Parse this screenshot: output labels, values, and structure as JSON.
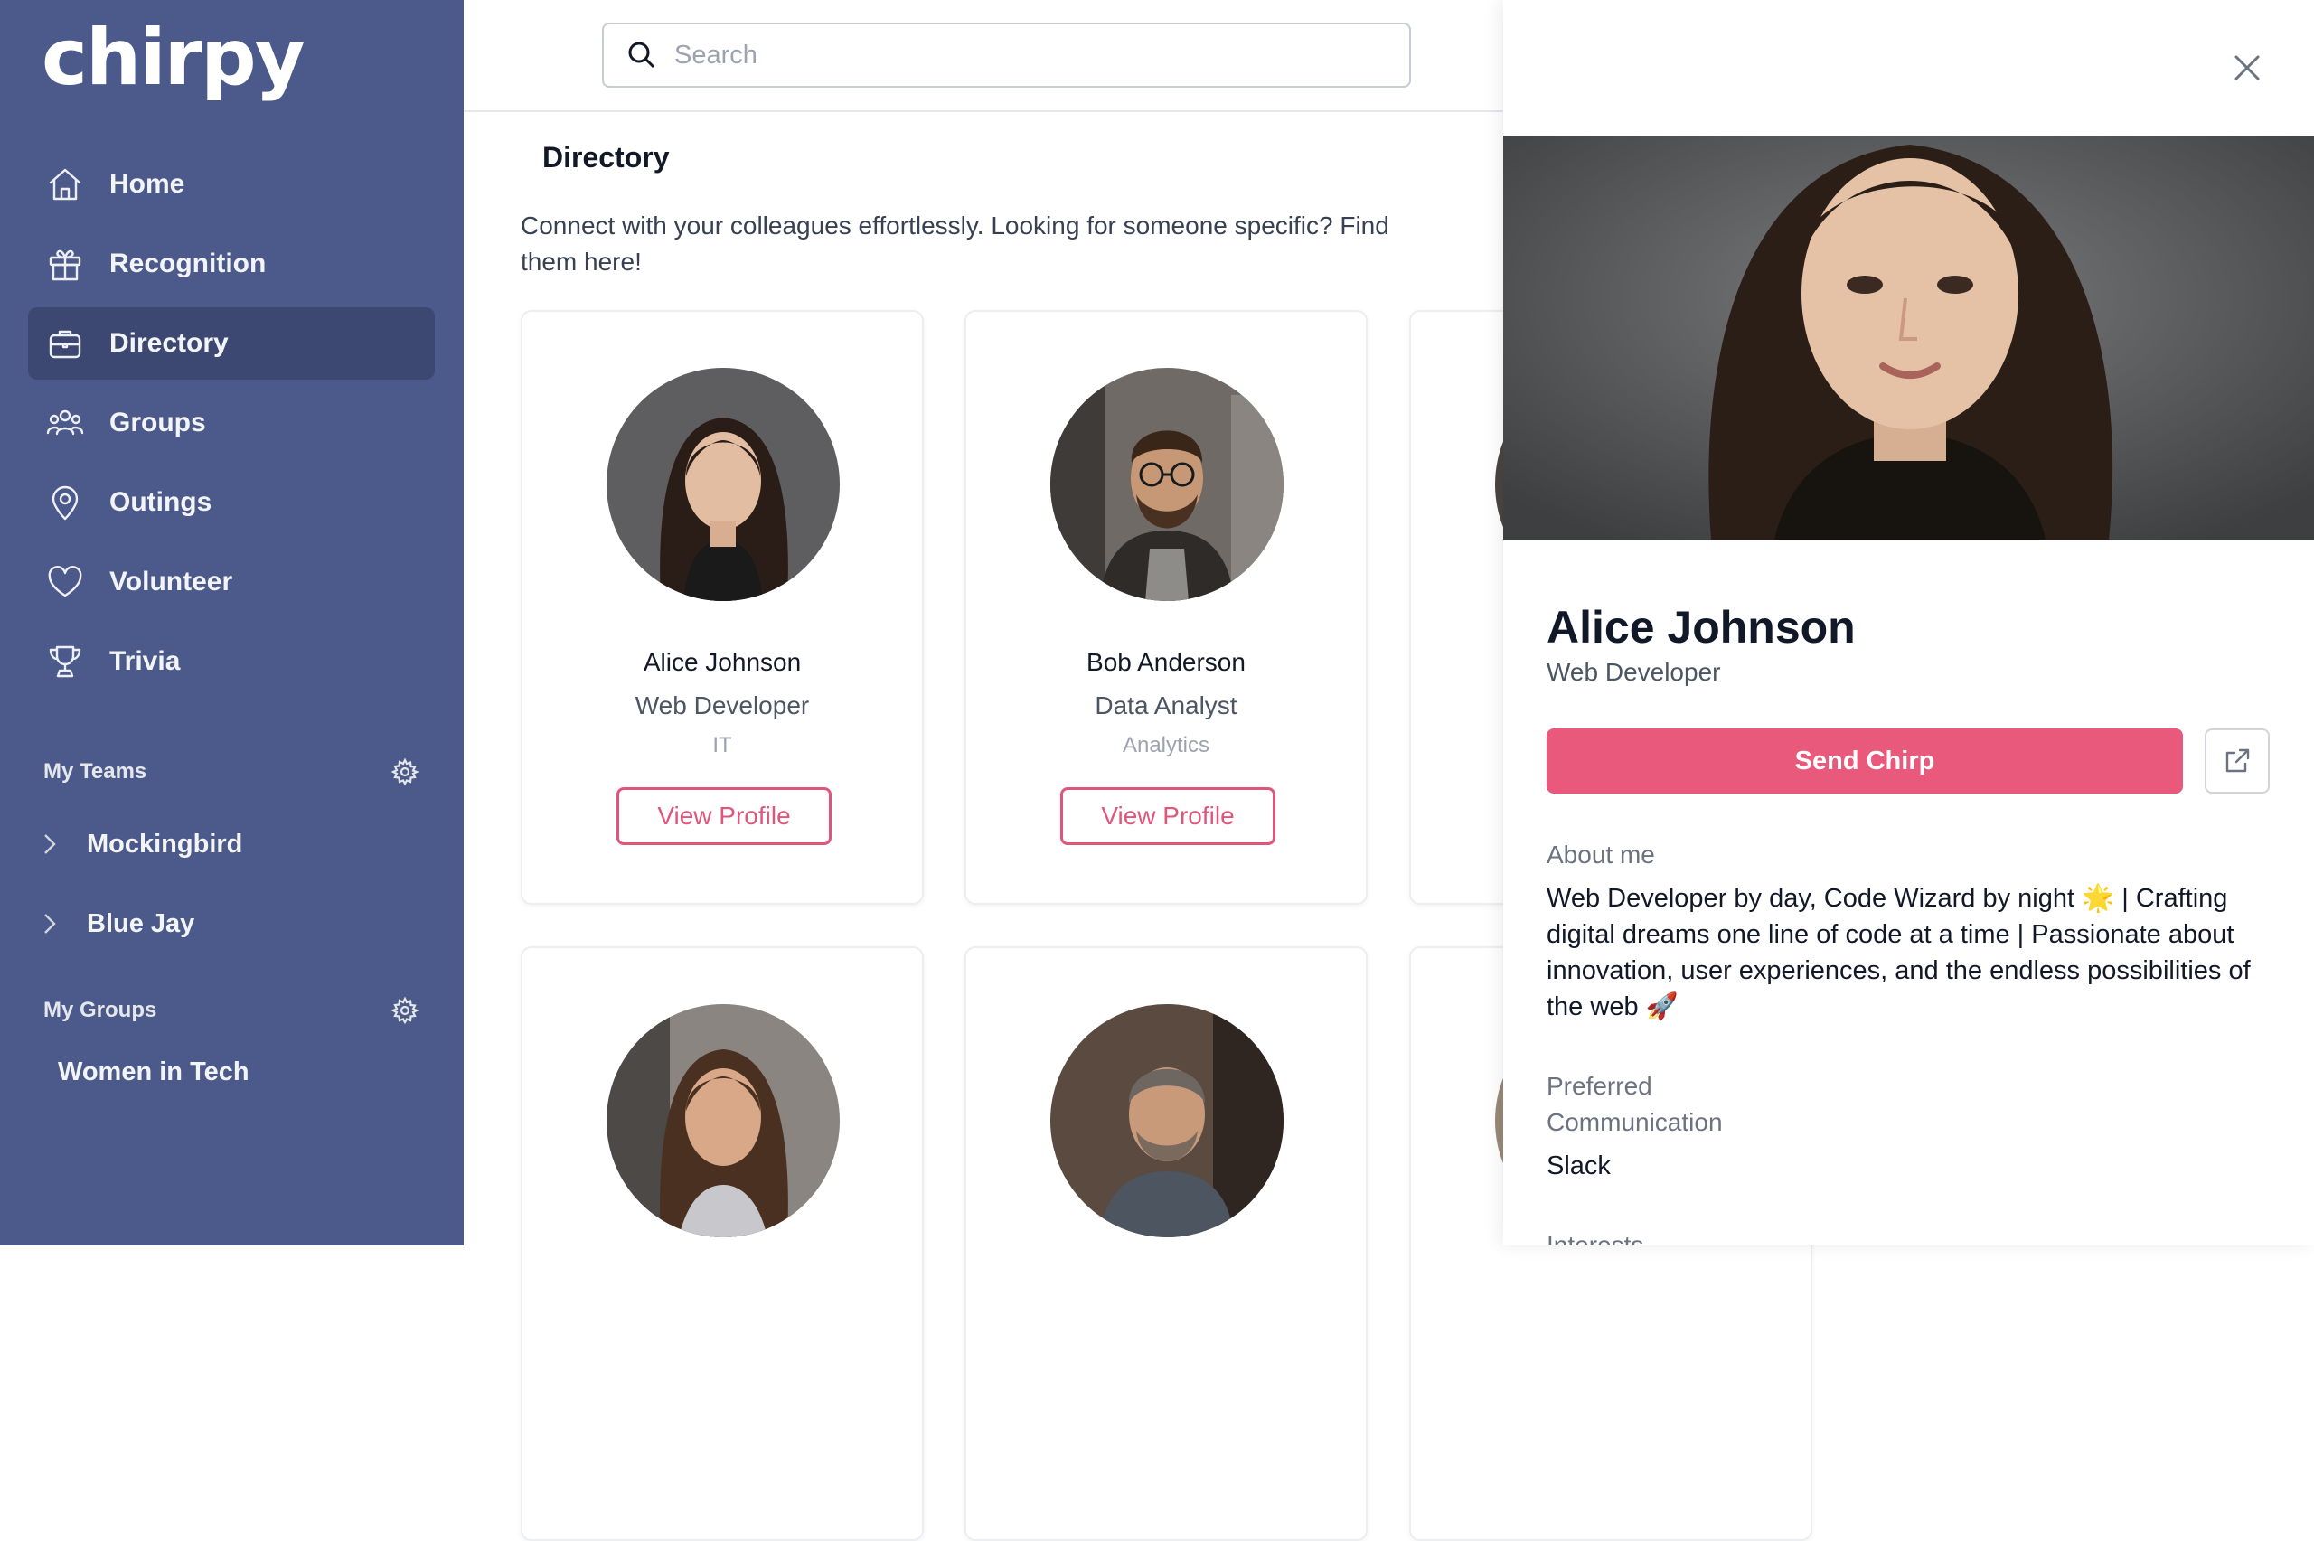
{
  "app": {
    "logo": "chirpy"
  },
  "sidebar": {
    "items": [
      {
        "label": "Home",
        "icon": "home-icon"
      },
      {
        "label": "Recognition",
        "icon": "gift-icon"
      },
      {
        "label": "Directory",
        "icon": "briefcase-icon",
        "active": true
      },
      {
        "label": "Groups",
        "icon": "users-icon"
      },
      {
        "label": "Outings",
        "icon": "map-pin-icon"
      },
      {
        "label": "Volunteer",
        "icon": "heart-icon"
      },
      {
        "label": "Trivia",
        "icon": "trophy-icon"
      }
    ],
    "my_teams_title": "My Teams",
    "teams": [
      "Mockingbird",
      "Blue Jay"
    ],
    "my_groups_title": "My Groups",
    "groups": [
      "Women in Tech"
    ]
  },
  "search": {
    "placeholder": "Search"
  },
  "main": {
    "title": "Directory",
    "description": "Connect with your colleagues effortlessly. Looking for someone specific? Find them here!",
    "cards": [
      {
        "name": "Alice Johnson",
        "role": "Web Developer",
        "dept": "IT",
        "button": "View Profile"
      },
      {
        "name": "Bob Anderson",
        "role": "Data Analyst",
        "dept": "Analytics",
        "button": "View Profile"
      }
    ]
  },
  "drawer": {
    "name": "Alice Johnson",
    "role": "Web Developer",
    "send_label": "Send Chirp",
    "about_label": "About me",
    "about_text": "Web Developer by day, Code Wizard by night 🌟 | Crafting digital dreams one line of code at a time | Passionate about innovation, user experiences, and the endless possibilities of the web 🚀",
    "pref_label": "Preferred Communication",
    "pref_value": "Slack",
    "interests_label": "Interests"
  },
  "colors": {
    "sidebar": "#4b5a8a",
    "active": "#3c4872",
    "accent": "#e8597c"
  }
}
